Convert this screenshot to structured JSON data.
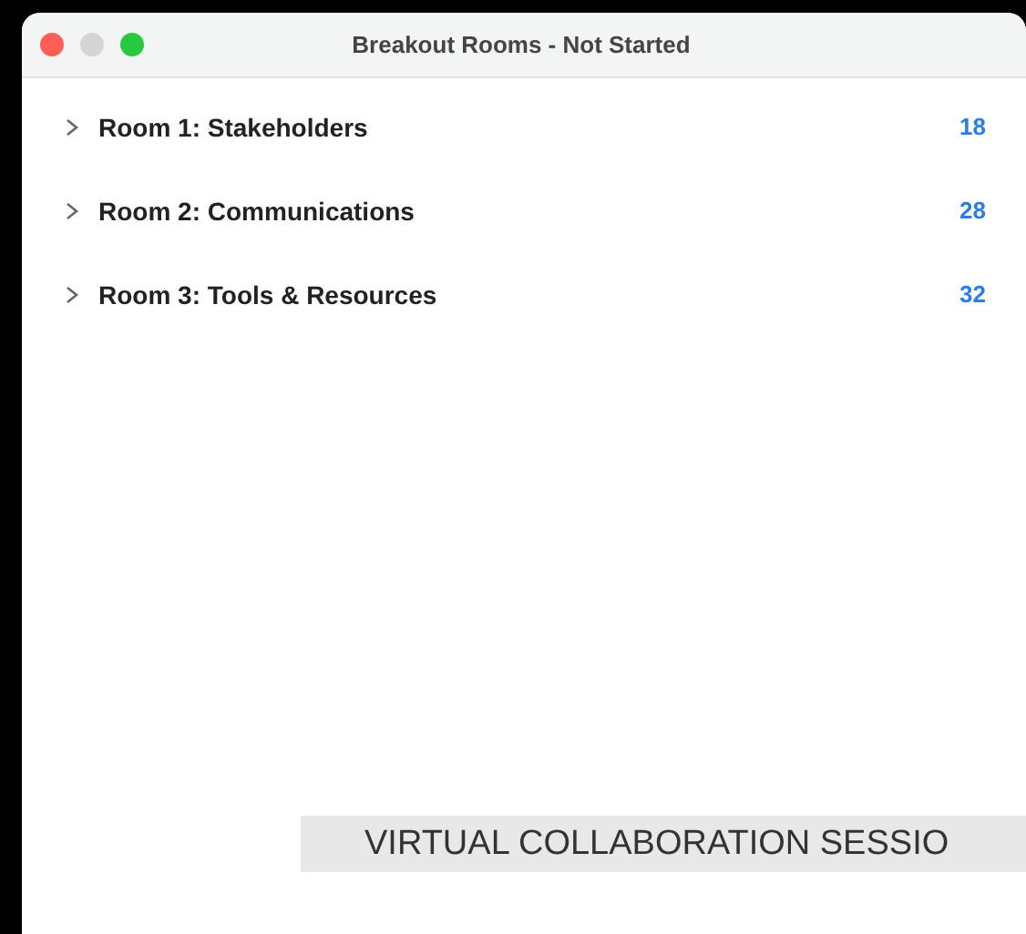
{
  "window": {
    "title": "Breakout Rooms - Not Started"
  },
  "rooms": [
    {
      "name": "Room 1: Stakeholders",
      "count": "18",
      "expanded": false
    },
    {
      "name": "Room 2: Communications",
      "count": "28",
      "expanded": false
    },
    {
      "name": "Room 3: Tools & Resources",
      "count": "32",
      "expanded": false
    }
  ],
  "caption": "VIRTUAL COLLABORATION SESSIO"
}
